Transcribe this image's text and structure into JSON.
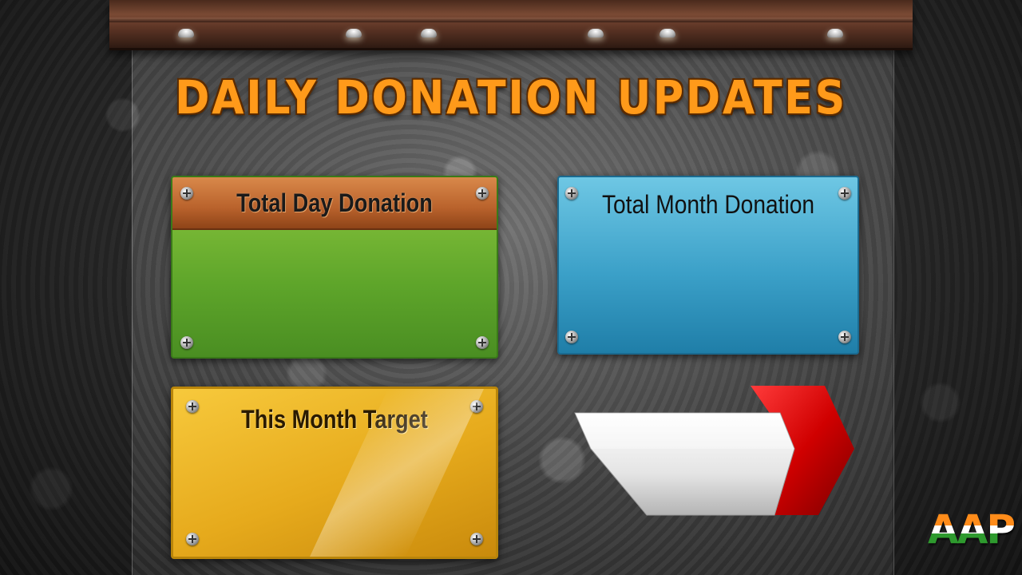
{
  "title": "DAILY DONATION UPDATES",
  "panels": {
    "day": {
      "label": "Total Day Donation",
      "color": "#6bb32e",
      "header_color": "#c4722e"
    },
    "month": {
      "label": "Total Month Donation",
      "color": "#3ba0c8"
    },
    "target": {
      "label": "This Month Target",
      "color": "#e8ae22"
    }
  },
  "logo": {
    "text": "AAP",
    "colors": [
      "#ff8c1a",
      "#ffffff",
      "#2e9a2e"
    ]
  },
  "icons": [
    "screw-icon",
    "spotlight-icon",
    "arrow-ribbon-icon"
  ]
}
